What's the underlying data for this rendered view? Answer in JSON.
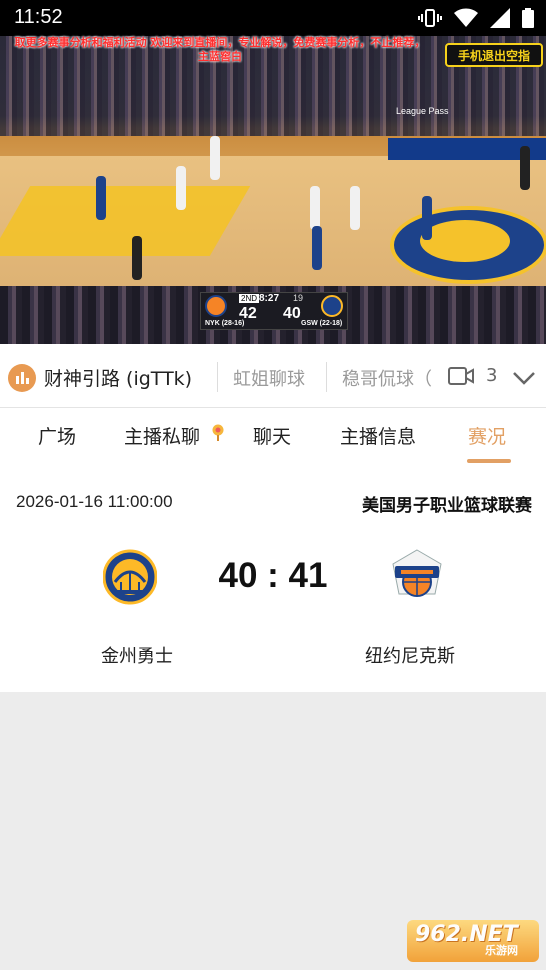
{
  "status_bar": {
    "time": "11:52",
    "icons": [
      "vibrate-icon",
      "wifi-icon",
      "signal-icon",
      "battery-icon"
    ]
  },
  "video": {
    "ticker_line1": "取更多赛事分析和福利活动 欢迎来到直播间，专业解说，免费赛事分析，不止推荐，",
    "ticker_line2": "主蓝窖白",
    "app_logo": "手机退出空指",
    "led_board": "League Pass",
    "scorebug": {
      "quarter": "2ND",
      "clock": "8:27",
      "shot_clock": "19",
      "away_score": "42",
      "home_score": "40",
      "away_team": "NYK (28-16)",
      "home_team": "GSW (22-18)"
    }
  },
  "channels": {
    "items": [
      "财神引路 (igTTk)",
      "虹姐聊球",
      "稳哥侃球（"
    ],
    "count": "3",
    "icon_color": "#e89a52"
  },
  "tabs": {
    "items": [
      "广场",
      "主播私聊",
      "聊天",
      "主播信息",
      "赛况"
    ],
    "active_index": 4,
    "accent_color": "#e2a064"
  },
  "match": {
    "datetime": "2026-01-16 11:00:00",
    "league": "美国男子职业篮球联赛",
    "score": "40 : 41",
    "home_team": "金州勇士",
    "away_team": "纽约尼克斯"
  },
  "watermark": {
    "main": "962.NET",
    "sub": "乐游网"
  }
}
